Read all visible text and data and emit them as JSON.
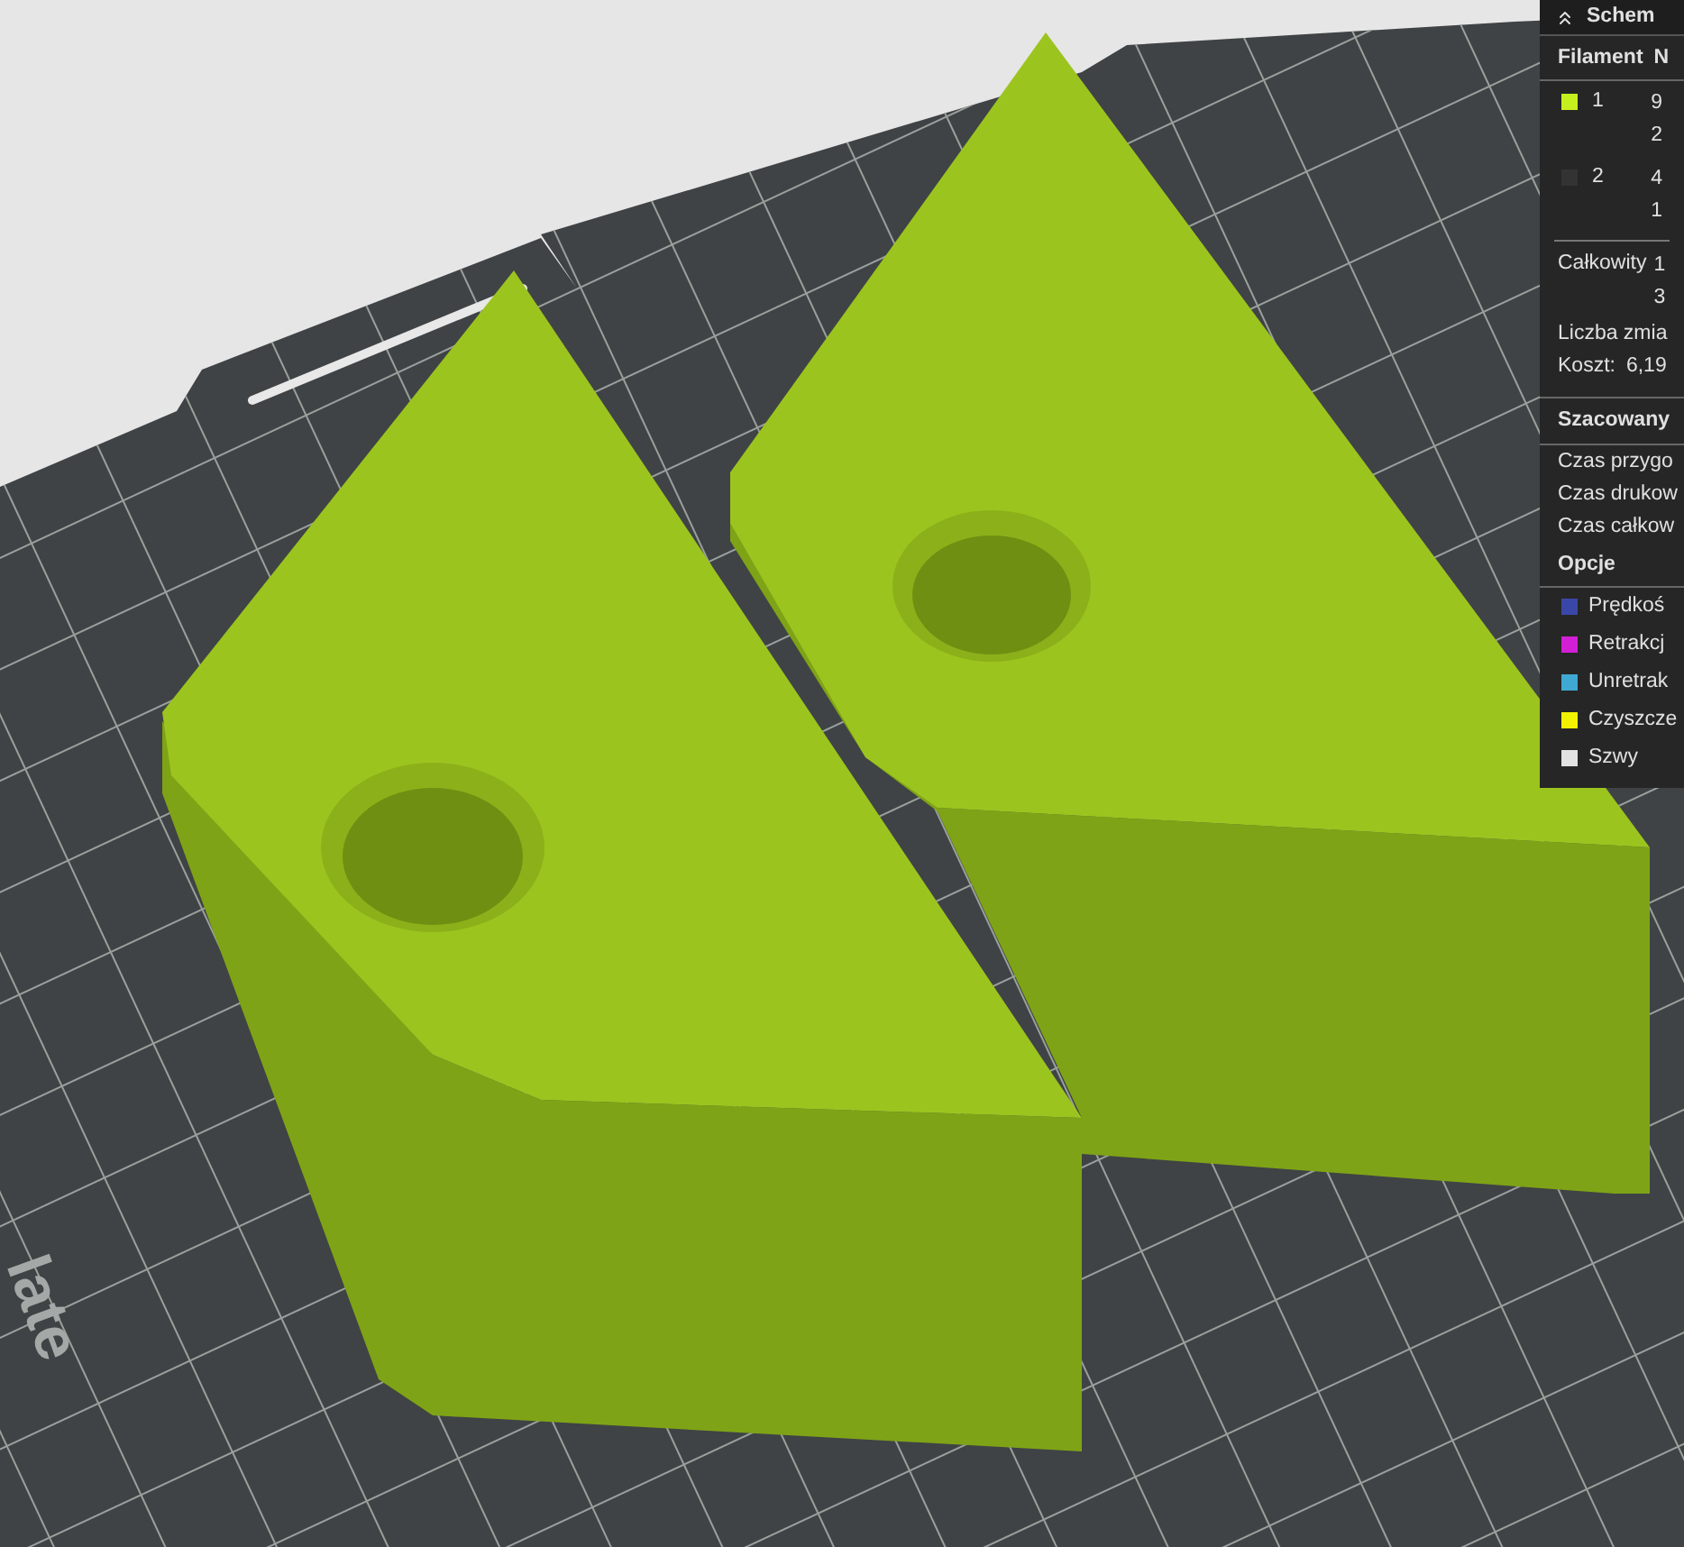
{
  "plate": {
    "label": "late"
  },
  "panel": {
    "title": "Schem",
    "columns": [
      "Filament",
      "N"
    ],
    "filaments": [
      {
        "label": "1",
        "color": "#c6ef1e",
        "values": [
          "9",
          "2"
        ]
      },
      {
        "label": "2",
        "color": "#333333",
        "values": [
          "4",
          "1"
        ]
      }
    ],
    "total": {
      "label": "Całkowity",
      "values": [
        "1",
        "3"
      ]
    },
    "changes": "Liczba zmia",
    "cost": {
      "label": "Koszt:",
      "value": "6,19"
    },
    "estimate": {
      "title": "Szacowany",
      "rows": [
        "Czas przygo",
        "Czas drukow",
        "Czas całkow"
      ]
    },
    "options": {
      "title": "Opcje",
      "items": [
        {
          "label": "Prędkoś",
          "color": "#3b47a8"
        },
        {
          "label": "Retrakcj",
          "color": "#d21fd6"
        },
        {
          "label": "Unretrak",
          "color": "#3fa9d3"
        },
        {
          "label": "Czyszcze",
          "color": "#f2f200"
        },
        {
          "label": "Szwy",
          "color": "#e2e2e2"
        }
      ]
    }
  }
}
